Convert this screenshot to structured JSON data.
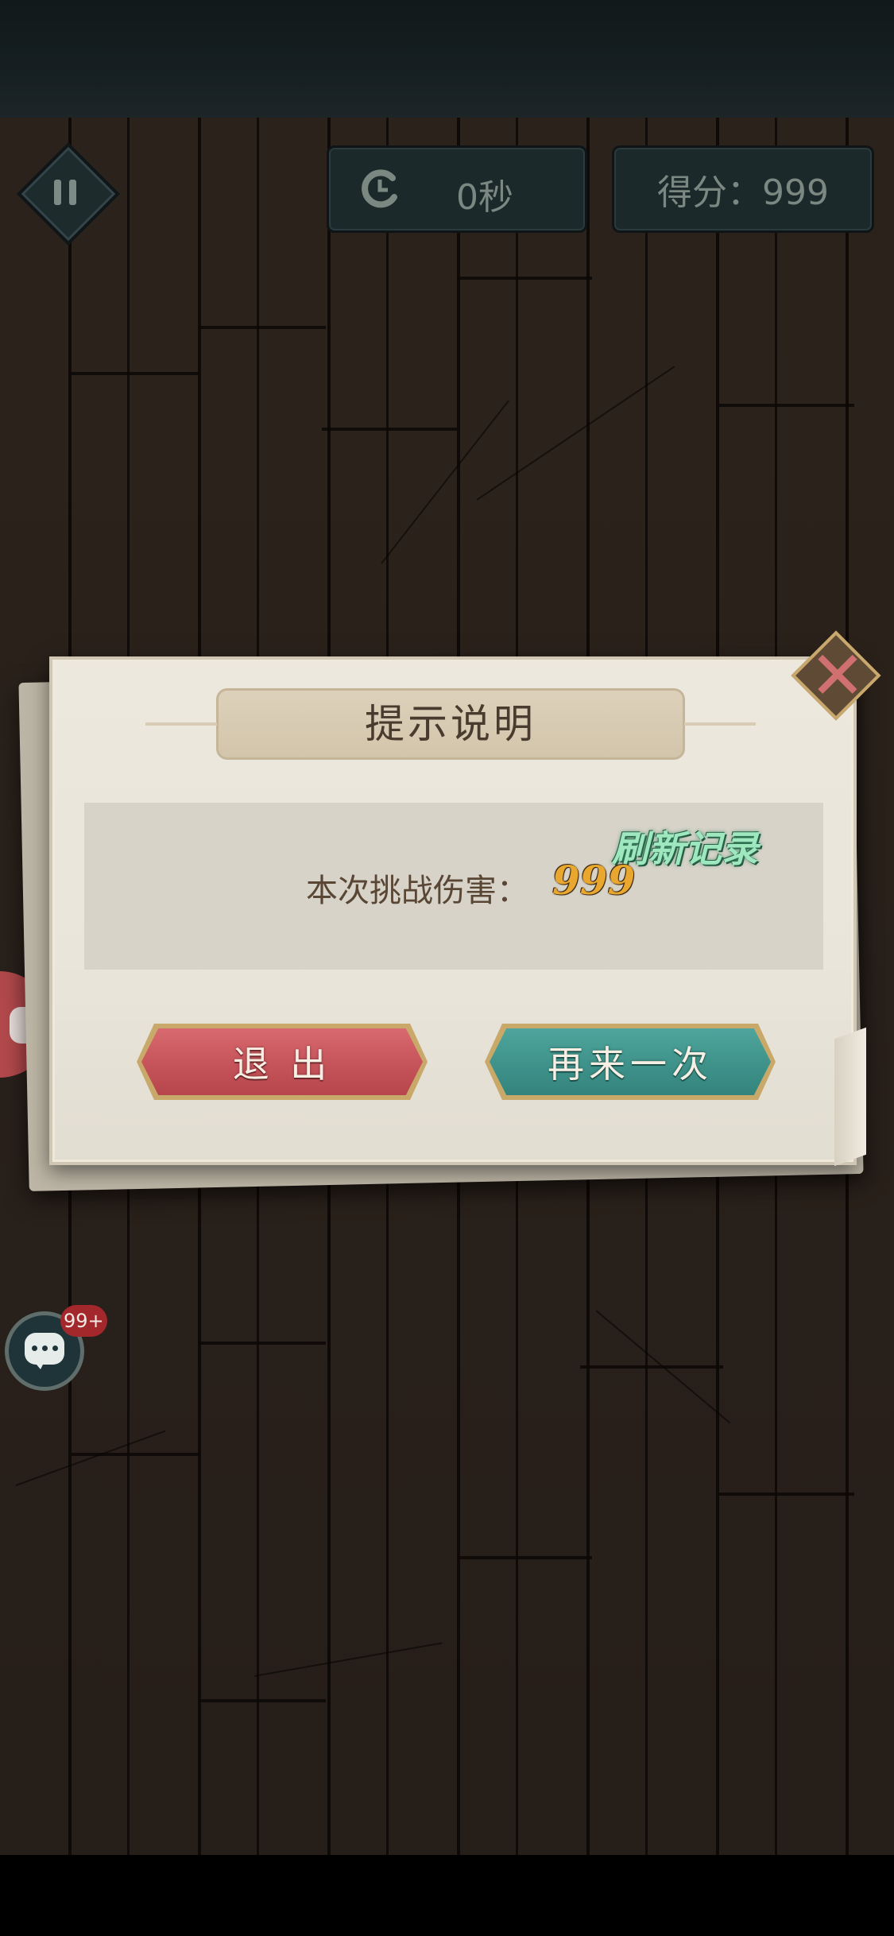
{
  "hud": {
    "timer_text": "0秒",
    "score_text": "得分：999",
    "pause_icon": "pause-icon",
    "timer_icon": "refresh-timer-icon"
  },
  "dialog": {
    "title": "提示说明",
    "result_label": "本次挑战伤害：",
    "result_value": "999",
    "record_tag": "刷新记录",
    "exit_label": "退 出",
    "retry_label": "再来一次",
    "close_icon": "close-x-icon"
  },
  "chat": {
    "badge": "99+",
    "icon": "chat-bubble-icon"
  },
  "colors": {
    "exit_button": "#c5535a",
    "retry_button": "#3e928a",
    "record_tag": "#9fe8bf",
    "result_value": "#e9a72f"
  }
}
